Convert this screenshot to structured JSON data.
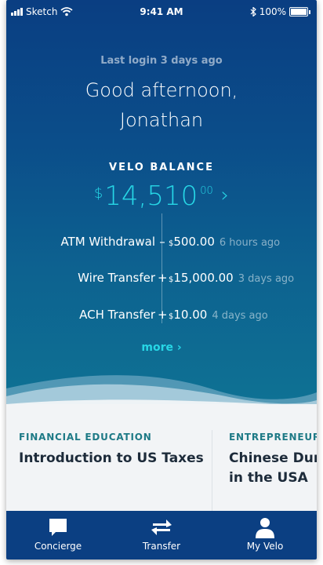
{
  "status_bar": {
    "carrier": "Sketch",
    "time": "9:41 AM",
    "battery": "100%"
  },
  "header": {
    "last_login": "Last login 3 days ago",
    "greeting_line1": "Good afternoon,",
    "greeting_line2": "Jonathan"
  },
  "balance": {
    "label": "VELO BALANCE",
    "currency": "$",
    "amount": "14,510",
    "cents": "00",
    "chevron": "›"
  },
  "transactions": [
    {
      "name": "ATM Withdrawal",
      "sign": "–",
      "currency": "$",
      "amount": "500.00",
      "time": "6 hours ago"
    },
    {
      "name": "Wire Transfer",
      "sign": "+",
      "currency": "$",
      "amount": "15,000.00",
      "time": "3 days ago"
    },
    {
      "name": "ACH Transfer",
      "sign": "+",
      "currency": "$",
      "amount": "10.00",
      "time": "4 days ago"
    }
  ],
  "more_link": "more ›",
  "cards": [
    {
      "category": "FINANCIAL EDUCATION",
      "title_line1": "Introduction to US Taxes",
      "title_line2": ""
    },
    {
      "category": "ENTREPRENEURS",
      "title_line1": "Chinese Dum",
      "title_line2": "in the USA"
    }
  ],
  "tabbar": {
    "tabs": [
      {
        "label": "Concierge",
        "icon": "chat-icon"
      },
      {
        "label": "Transfer",
        "icon": "transfer-arrows-icon"
      },
      {
        "label": "My Velo",
        "icon": "person-icon"
      }
    ]
  },
  "colors": {
    "hero_top": "#0a3e82",
    "hero_bottom": "#0e7394",
    "accent_cyan": "#27d7e6",
    "category_teal": "#1e7a86",
    "tabbar_bg": "#0b3f82"
  }
}
